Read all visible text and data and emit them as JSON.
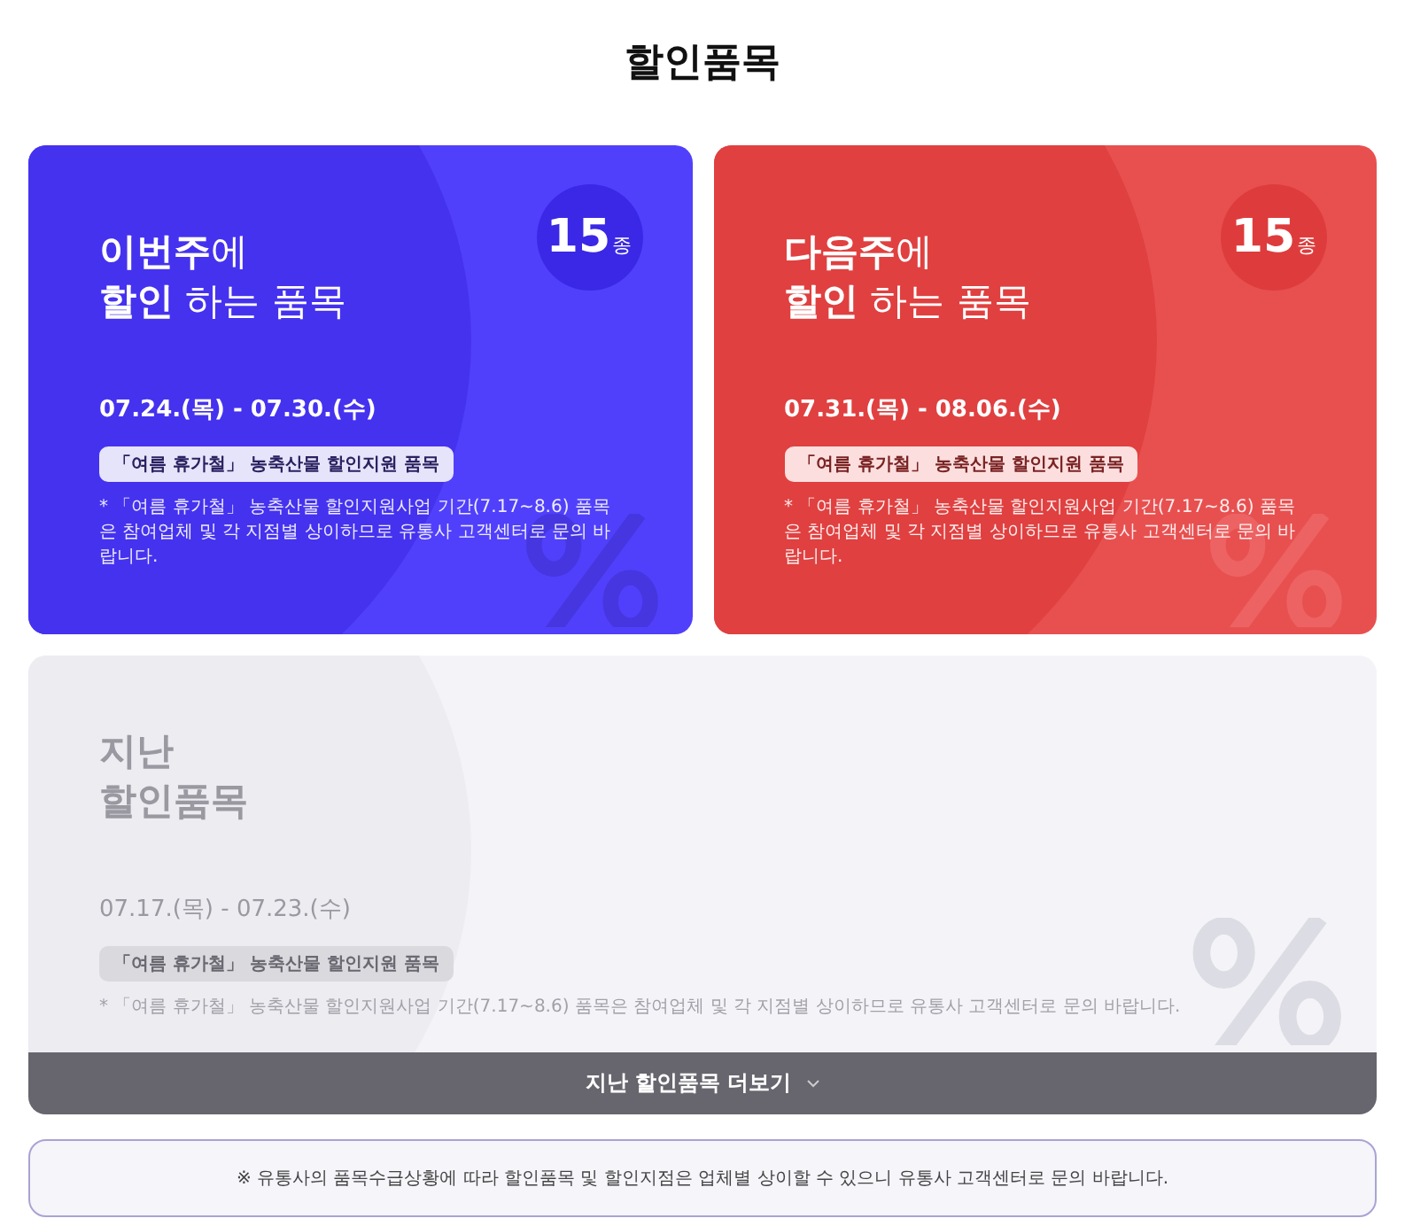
{
  "page_title": "할인품목",
  "cards": [
    {
      "kind": "current",
      "title_lines": [
        "**이번주**에",
        "**할인** 하는 품목"
      ],
      "count": "15",
      "count_unit": "종",
      "period": "07.24.(목) - 07.30.(수)",
      "tag": "「여름 휴가철」 농축산물 할인지원 품목",
      "note": "* 「여름 휴가철」 농축산물 할인지원사업 기간(7.17~8.6) 품목은 참여업체 및 각 지점별 상이하므로 유통사 고객센터로 문의 바랍니다."
    },
    {
      "kind": "next",
      "title_lines": [
        "**다음주**에",
        "**할인** 하는 품목"
      ],
      "count": "15",
      "count_unit": "종",
      "period": "07.31.(목) - 08.06.(수)",
      "tag": "「여름 휴가철」 농축산물 할인지원 품목",
      "note": "* 「여름 휴가철」 농축산물 할인지원사업 기간(7.17~8.6) 품목은 참여업체 및 각 지점별 상이하므로 유통사 고객센터로 문의 바랍니다."
    },
    {
      "kind": "past",
      "title_lines": [
        "지난",
        "할인품목"
      ],
      "period": "07.17.(목) - 07.23.(수)",
      "tag": "「여름 휴가철」 농축산물 할인지원 품목",
      "note": "* 「여름 휴가철」 농축산물 할인지원사업 기간(7.17~8.6) 품목은 참여업체 및 각 지점별 상이하므로 유통사 고객센터로 문의 바랍니다.",
      "more_button": "지난 할인품목 더보기"
    }
  ],
  "notice": "※ 유통사의 품목수급상황에 따라 할인품목 및 할인지점은 업체별 상이할 수 있으니 유통사 고객센터로 문의 바랍니다."
}
